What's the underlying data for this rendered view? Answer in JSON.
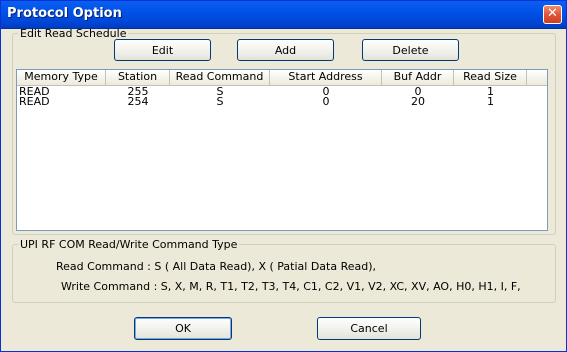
{
  "window": {
    "title": "Protocol Option",
    "close_glyph": "✕"
  },
  "schedule_group": {
    "legend": "Edit Read Schedule",
    "buttons": {
      "edit": "Edit",
      "add": "Add",
      "delete": "Delete"
    },
    "columns": [
      "Memory Type",
      "Station",
      "Read Command",
      "Start Address",
      "Buf Addr",
      "Read Size"
    ],
    "rows": [
      [
        "READ",
        "255",
        "S",
        "0",
        "0",
        "1"
      ],
      [
        "READ",
        "254",
        "S",
        "0",
        "20",
        "1"
      ]
    ]
  },
  "command_group": {
    "legend": "UPI RF COM Read/Write Command Type",
    "read_line": "Read Command : S ( All Data Read), X ( Patial Data Read),",
    "write_line": "Write Command : S, X, M, R, T1, T2, T3, T4, C1, C2, V1, V2, XC, XV, AO, H0, H1, I, F,"
  },
  "footer": {
    "ok": "OK",
    "cancel": "Cancel"
  }
}
